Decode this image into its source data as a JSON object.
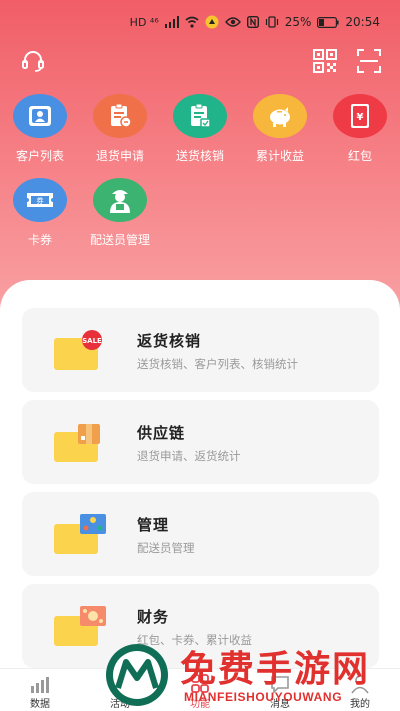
{
  "status_bar": {
    "carrier_badges": "HD ⁴⁶",
    "battery": "25%",
    "time": "20:54"
  },
  "topbar": {
    "left_icon": "headset-icon",
    "right_icons": [
      "qr-code-icon",
      "scan-icon"
    ]
  },
  "shortcuts": [
    {
      "label": "客户列表",
      "icon": "customer-card-icon",
      "color": "#4a90e2"
    },
    {
      "label": "退货申请",
      "icon": "return-doc-icon",
      "color": "#f0704a"
    },
    {
      "label": "送货核销",
      "icon": "delivery-doc-icon",
      "color": "#21b38a"
    },
    {
      "label": "累计收益",
      "icon": "piggy-bank-icon",
      "color": "#f6b73c"
    },
    {
      "label": "红包",
      "icon": "red-envelope-icon",
      "color": "#ef3b45"
    },
    {
      "label": "卡券",
      "icon": "coupon-icon",
      "color": "#4a90e2"
    },
    {
      "label": "配送员管理",
      "icon": "courier-icon",
      "color": "#3cb371"
    }
  ],
  "cards": [
    {
      "title": "返货核销",
      "subtitle": "送货核销、客户列表、核销统计",
      "thumb_badge": "SALE"
    },
    {
      "title": "供应链",
      "subtitle": "退货申请、返货统计"
    },
    {
      "title": "管理",
      "subtitle": "配送员管理"
    },
    {
      "title": "财务",
      "subtitle": "红包、卡券、累计收益"
    }
  ],
  "tabs": [
    {
      "label": "数据",
      "icon": "bar-chart-icon",
      "active": false
    },
    {
      "label": "活动",
      "icon": "activity-icon",
      "active": false
    },
    {
      "label": "功能",
      "icon": "grid-icon",
      "active": true
    },
    {
      "label": "消息",
      "icon": "message-icon",
      "active": false
    },
    {
      "label": "我的",
      "icon": "profile-icon",
      "active": false
    }
  ],
  "watermark": {
    "title": "免费手游网",
    "subtitle": "MIANFEISHOUYOUWANG"
  },
  "colors": {
    "header_top": "#f15e67",
    "header_bottom": "#f9a4a6",
    "active_tab": "#e8444c",
    "card_bg": "#f5f5f5",
    "watermark_red": "#e0312f"
  }
}
